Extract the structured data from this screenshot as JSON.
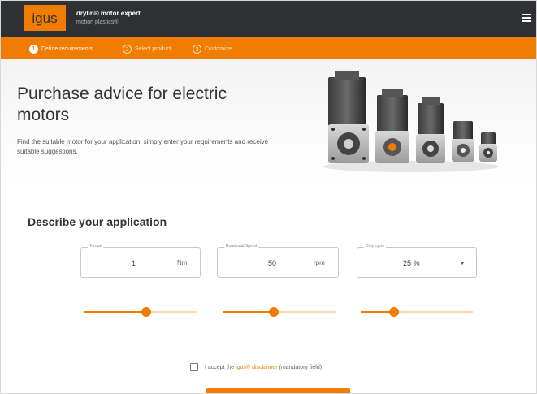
{
  "header": {
    "logo_text": "igus",
    "app_title": "drylin® motor expert",
    "app_subtitle": "motion plastics®",
    "menu_icon": "hamburger-menu-icon"
  },
  "steps": [
    {
      "number": "1",
      "label": "Define requirements",
      "active": true
    },
    {
      "number": "2",
      "label": "Select product",
      "active": false
    },
    {
      "number": "3",
      "label": "Customize",
      "active": false
    }
  ],
  "hero": {
    "title": "Purchase advice for electric motors",
    "description": "Find the suitable motor for your application: simply enter your requirements and receive suitable suggestions."
  },
  "application": {
    "heading": "Describe your application",
    "fields": [
      {
        "label": "Torque",
        "value": "1",
        "unit": "Nm"
      },
      {
        "label": "Rotational Speed",
        "value": "50",
        "unit": "rpm"
      },
      {
        "label": "Duty cycle",
        "value": "25 %",
        "unit": ""
      }
    ],
    "sliders": [
      0.55,
      0.45,
      0.3
    ],
    "consent_prefix": "I accept the",
    "consent_link": "igus® disclaimer",
    "consent_suffix": "(mandatory field)"
  },
  "colors": {
    "accent": "#f07d00",
    "header_bg": "#2f3033"
  }
}
